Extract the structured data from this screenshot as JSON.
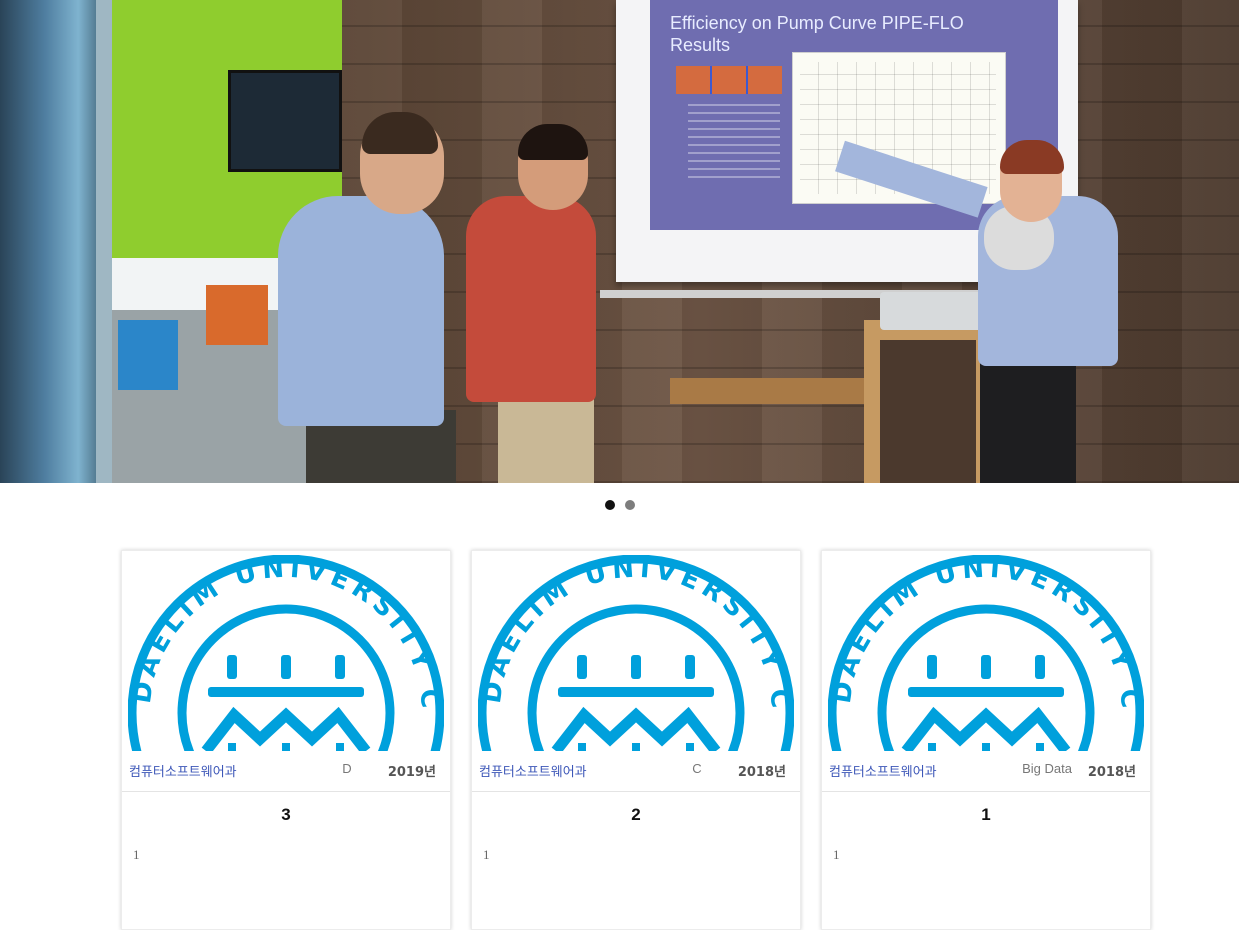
{
  "hero": {
    "slide_title": "Efficiency on Pump Curve PIPE-FLO Results"
  },
  "carousel": {
    "slide_count": 2,
    "active_index": 0
  },
  "seal": {
    "text": "DAELIM UNIVERSITY COLLEGE",
    "color": "#00A0DC"
  },
  "cards": [
    {
      "dept": "컴퓨터소프트웨어과",
      "tag": "D",
      "year": "2019년",
      "title": "3",
      "body": "1"
    },
    {
      "dept": "컴퓨터소프트웨어과",
      "tag": "C",
      "year": "2018년",
      "title": "2",
      "body": "1"
    },
    {
      "dept": "컴퓨터소프트웨어과",
      "tag": "Big Data",
      "year": "2018년",
      "title": "1",
      "body": "1"
    }
  ]
}
